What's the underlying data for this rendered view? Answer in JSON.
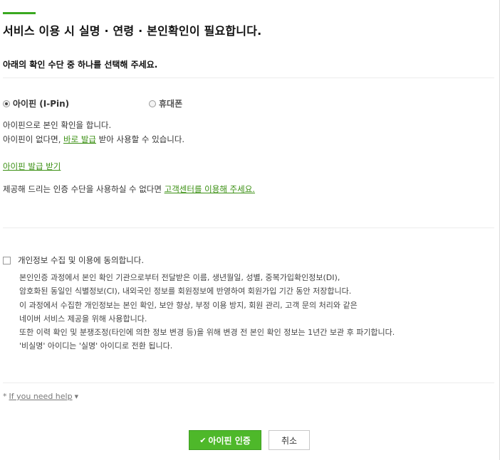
{
  "header": {
    "title": "서비스 이용 시 실명 · 연령 · 본인확인이 필요합니다.",
    "subtitle": "아래의 확인 수단 중 하나를 선택해 주세요."
  },
  "methods": {
    "ipin": {
      "label": "아이핀 (I-Pin)",
      "selected": true
    },
    "phone": {
      "label": "휴대폰",
      "selected": false
    }
  },
  "ipin_info": {
    "line1": "아이핀으로 본인 확인을 합니다.",
    "line2_prefix": "아이핀이 없다면, ",
    "line2_link": "바로 발급",
    "line2_suffix": " 받아 사용할 수 있습니다.",
    "issue_link": "아이핀 발급 받기",
    "support_prefix": "제공해 드리는 인증 수단을 사용하실 수 없다면 ",
    "support_link": "고객센터를 이용해 주세요."
  },
  "agreement": {
    "label": "개인정보 수집 및 이용에 동의합니다.",
    "checked": false,
    "body": [
      "본인인증 과정에서 본인 확인 기관으로부터 전달받은 이름, 생년월일, 성별, 중복가입확인정보(DI),",
      "암호화된 동일인 식별정보(CI), 내외국인 정보를 회원정보에 반영하여 회원가입 기간 동안 저장합니다.",
      "이 과정에서 수집한 개인정보는 본인 확인, 보안 향상, 부정 이용 방지, 회원 관리, 고객 문의 처리와 같은",
      "네이버 서비스 제공을 위해 사용합니다.",
      "또한 이력 확인 및 분쟁조정(타인에 의한 정보 변경 등)을 위해 변경 전 본인 확인 정보는 1년간 보관 후 파기합니다.",
      "'비실명' 아이디는 '실명' 아이디로 전환 됩니다."
    ]
  },
  "help": {
    "bullet": "*",
    "label": "If you need help",
    "caret": "▼"
  },
  "actions": {
    "confirm_icon": "check-icon",
    "confirm_label": "아이핀 인증",
    "cancel_label": "취소"
  },
  "colors": {
    "accent": "#3aa820",
    "link": "#3a8f12",
    "confirm_bg": "#4eb82a"
  }
}
